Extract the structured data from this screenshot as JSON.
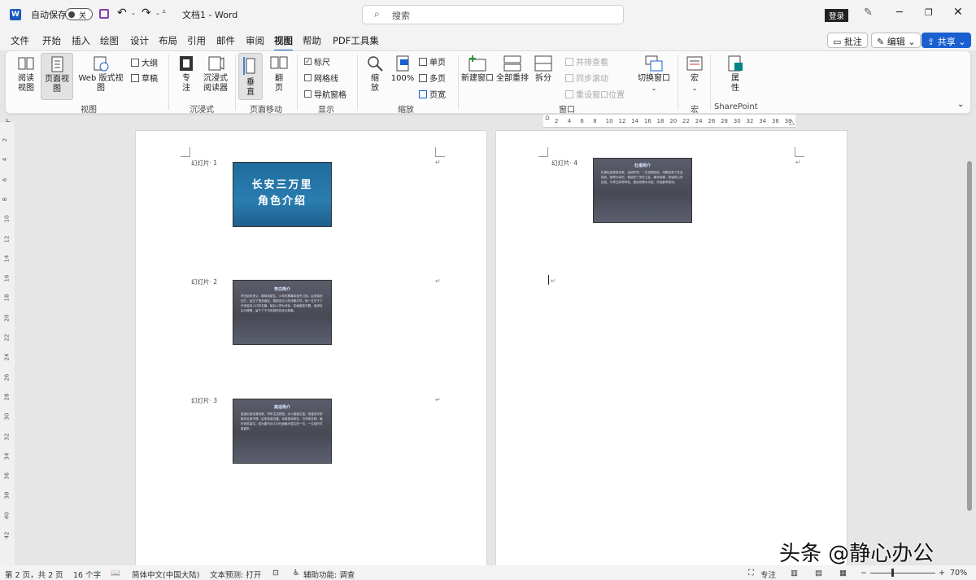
{
  "titlebar": {
    "autosave_label": "自动保存",
    "autosave_state": "关",
    "doc_title": "文档1 - Word",
    "search_placeholder": "搜索",
    "login_label": "登录"
  },
  "tabs": [
    "文件",
    "开始",
    "插入",
    "绘图",
    "设计",
    "布局",
    "引用",
    "邮件",
    "审阅",
    "视图",
    "帮助",
    "PDF工具集"
  ],
  "active_tab": "视图",
  "header_buttons": {
    "comment": "批注",
    "edit": "编辑",
    "share": "共享"
  },
  "ribbon": {
    "views": {
      "read": "阅读\n视图",
      "print": "页面视图",
      "web": "Web 版式视图",
      "outline": "大纲",
      "draft": "草稿",
      "group": "视图"
    },
    "immersive": {
      "focus": "专\n注",
      "reader": "沉浸式\n阅读器",
      "group": "沉浸式"
    },
    "page_move": {
      "vertical": "垂\n直",
      "flip": "翻\n页",
      "group": "页面移动"
    },
    "show": {
      "ruler": "标尺",
      "gridlines": "网格线",
      "nav": "导航窗格",
      "group": "显示"
    },
    "zoom": {
      "zoom": "缩\n放",
      "hundred": "100%",
      "one": "单页",
      "multi": "多页",
      "width": "页宽",
      "group": "缩放"
    },
    "window": {
      "new": "新建窗口",
      "arrange": "全部重排",
      "split": "拆分",
      "side": "并排查看",
      "sync": "同步滚动",
      "reset": "重设窗口位置",
      "switch": "切换窗口",
      "group": "窗口"
    },
    "macros": {
      "macro": "宏",
      "group": "宏"
    },
    "sharepoint": {
      "props": "属\n性",
      "group": "SharePoint"
    }
  },
  "ruler_numbers": [
    "2",
    "4",
    "6",
    "8",
    "10",
    "12",
    "14",
    "16",
    "18",
    "20",
    "22",
    "24",
    "26",
    "28",
    "30",
    "32",
    "34",
    "36",
    "38"
  ],
  "vruler_numbers": [
    "2",
    "4",
    "6",
    "8",
    "10",
    "12",
    "14",
    "16",
    "18",
    "20",
    "22",
    "24",
    "26",
    "28",
    "30",
    "32",
    "34",
    "36",
    "38",
    "40",
    "42"
  ],
  "slides": [
    {
      "label": "幻灯片· 1",
      "title": "长安三万里\n角色介绍"
    },
    {
      "label": "幻灯片· 2",
      "title": "李白简介",
      "body": "李白幼年丧父，随母亲居住，少年时期喜欢读书习剑。后来游历四方，结交了很多朋友，展现出过人的诗歌才华。他一生写下了许多脍炙人口的名篇，被后人誉为诗仙，性格豪放不羁，追求自由与理想，留下了千古传颂的作品与故事。"
    },
    {
      "label": "幻灯片· 3",
      "title": "高适简介",
      "body": "高适出身没落世家，早年生活贫困，为人豪爽正直。他曾多次求取功名而不得，后来投身边塞，诗风雄浑悲壮，与岑参并称。晚年官至高位，成为唐代诗人中仕途最为显达的一位，一生经历丰富曲折。"
    },
    {
      "label": "幻灯片· 4",
      "title": "杜甫简介",
      "body": "杜甫出身官宦世家，自幼好学，一生忧国忧民，诗歌反映了社会现实，被誉为诗史。他经历了安史之乱，颠沛流离，却始终心系百姓，与李白并称李杜，被后世尊为诗圣，作品影响深远。"
    }
  ],
  "status": {
    "page": "第 2 页，共 2 页",
    "words": "16 个字",
    "lang": "简体中文(中国大陆)",
    "predict": "文本预测: 打开",
    "access": "辅助功能: 调查",
    "focus": "专注",
    "zoom": "70%"
  },
  "watermark": "头条 @静心办公",
  "colors": {
    "accent": "#185abd",
    "share": "#1a5fd0",
    "slide_blue": "#1f6c9e",
    "slide_dark": "#4d4f5c"
  }
}
